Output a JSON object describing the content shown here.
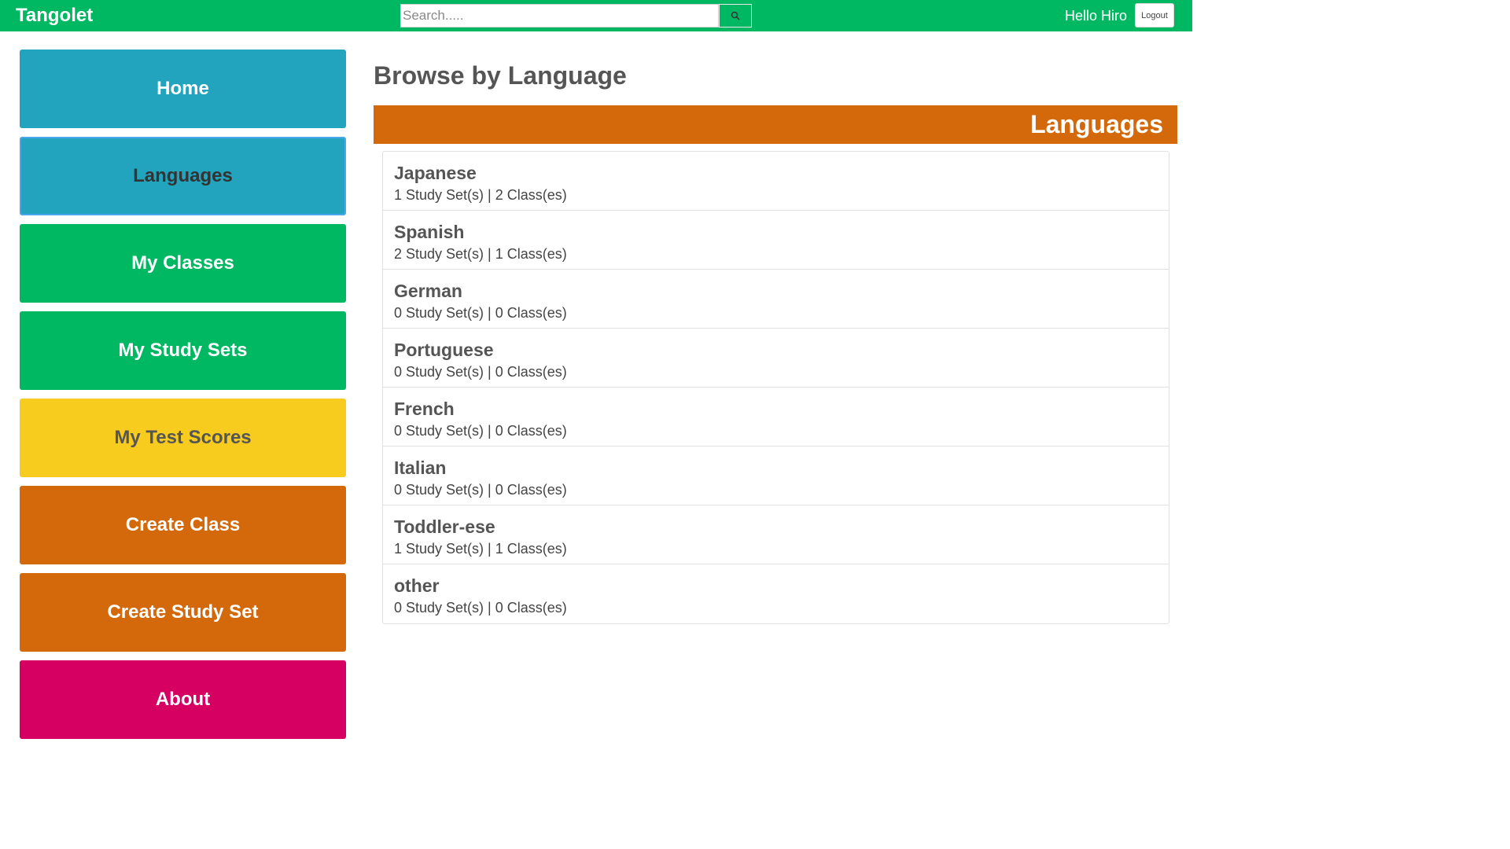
{
  "header": {
    "brand": "Tangolet",
    "search_placeholder": "Search.....",
    "search_icon": "search-icon",
    "greeting": "Hello Hiro",
    "logout_label": "Logout",
    "bg_color": "#00b862"
  },
  "sidebar": {
    "items": [
      {
        "label": "Home",
        "color": "#22a4bf",
        "active": false
      },
      {
        "label": "Languages",
        "color": "#22a4bf",
        "active": true
      },
      {
        "label": "My Classes",
        "color": "#00b862",
        "active": false
      },
      {
        "label": "My Study Sets",
        "color": "#00b862",
        "active": false
      },
      {
        "label": "My Test Scores",
        "color": "#f7cc1f",
        "active": false
      },
      {
        "label": "Create Class",
        "color": "#d4690b",
        "active": false
      },
      {
        "label": "Create Study Set",
        "color": "#d4690b",
        "active": false
      },
      {
        "label": "About",
        "color": "#d50061",
        "active": false
      }
    ]
  },
  "main": {
    "title": "Browse by Language",
    "section_title": "Languages",
    "section_color": "#d4690b",
    "languages": [
      {
        "name": "Japanese",
        "stats": "1 Study Set(s) | 2 Class(es)"
      },
      {
        "name": "Spanish",
        "stats": "2 Study Set(s) | 1 Class(es)"
      },
      {
        "name": "German",
        "stats": "0 Study Set(s) | 0 Class(es)"
      },
      {
        "name": "Portuguese",
        "stats": "0 Study Set(s) | 0 Class(es)"
      },
      {
        "name": "French",
        "stats": "0 Study Set(s) | 0 Class(es)"
      },
      {
        "name": "Italian",
        "stats": "0 Study Set(s) | 0 Class(es)"
      },
      {
        "name": "Toddler-ese",
        "stats": "1 Study Set(s) | 1 Class(es)"
      },
      {
        "name": "other",
        "stats": "0 Study Set(s) | 0 Class(es)"
      }
    ]
  }
}
